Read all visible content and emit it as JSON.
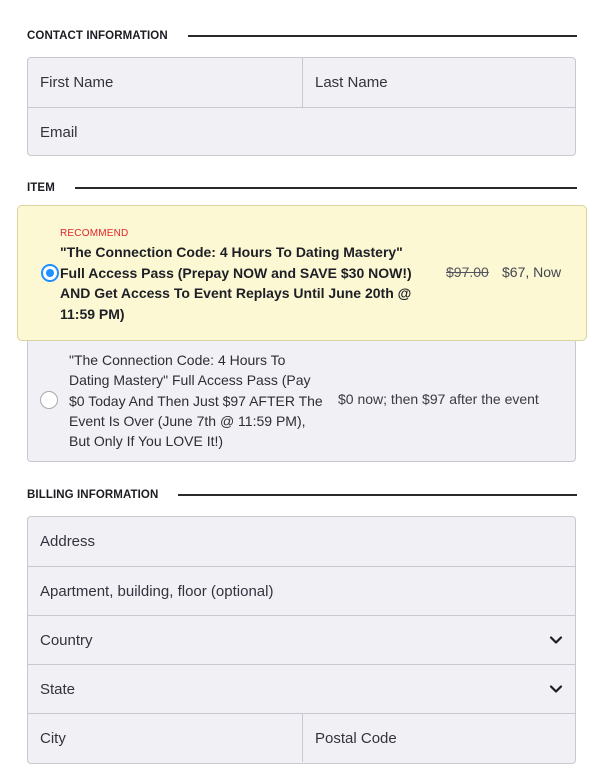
{
  "contact": {
    "title": "CONTACT INFORMATION",
    "first_name_placeholder": "First Name",
    "last_name_placeholder": "Last Name",
    "email_placeholder": "Email"
  },
  "item": {
    "title": "ITEM",
    "options": [
      {
        "badge": "RECOMMEND",
        "name": "\"The Connection Code: 4 Hours To Dating Mastery\" Full Access Pass (Prepay NOW and SAVE $30 NOW!) AND Get Access To Event Replays Until June 20th @ 11:59 PM)",
        "original_price": "$97.00",
        "price": "$67, Now",
        "selected": true
      },
      {
        "name": "\"The Connection Code: 4 Hours To Dating Mastery\" Full Access Pass (Pay $0 Today And Then Just $97 AFTER The Event Is Over (June 7th @ 11:59 PM), But Only If You LOVE It!)",
        "price": "$0 now; then $97 after the event",
        "selected": false
      }
    ]
  },
  "billing": {
    "title": "BILLING INFORMATION",
    "address_placeholder": "Address",
    "apartment_placeholder": "Apartment, building, floor (optional)",
    "country_placeholder": "Country",
    "state_placeholder": "State",
    "city_placeholder": "City",
    "postal_placeholder": "Postal Code"
  },
  "colors": {
    "accent": "#1e90ff",
    "badge_red": "#e0262b",
    "recommended_bg": "#fbf8d3",
    "field_bg": "#f0f0f5"
  },
  "icons": {
    "dropdown": "chevron-down-icon"
  }
}
